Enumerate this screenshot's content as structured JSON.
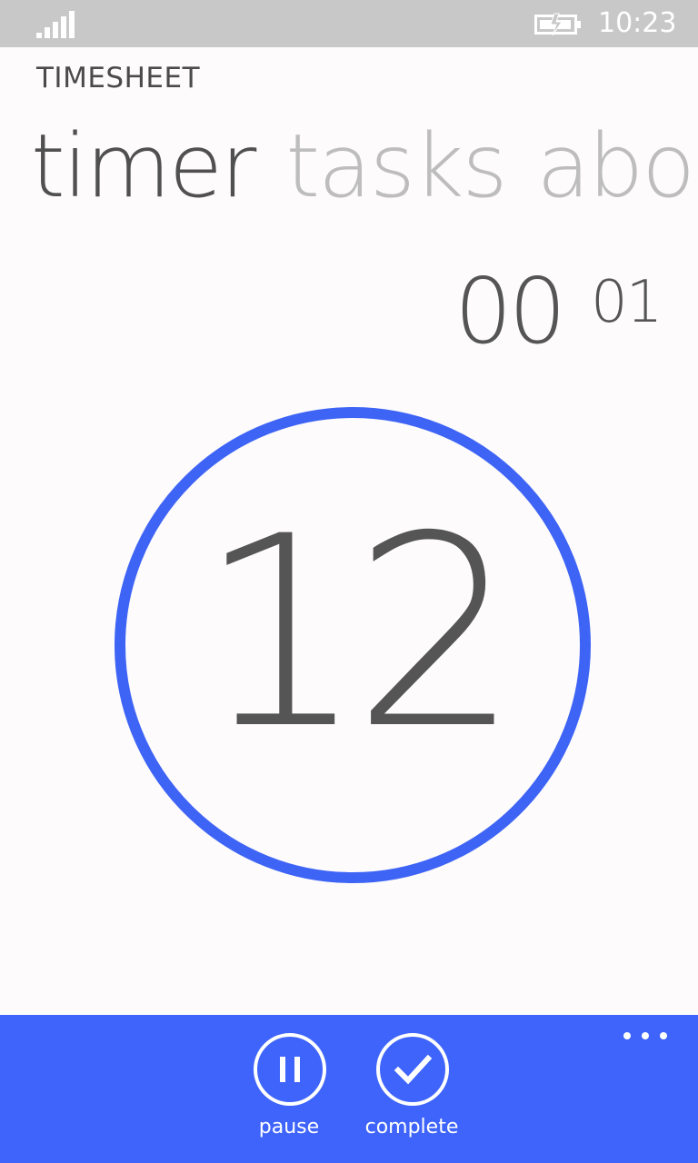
{
  "status_bar": {
    "time": "10:23",
    "signal_icon": "signal-strength-icon",
    "battery_icon": "battery-charging-icon"
  },
  "app": {
    "title": "TIMESHEET"
  },
  "pivot": {
    "items": [
      {
        "label": "timer",
        "active": true
      },
      {
        "label": "tasks",
        "active": false
      },
      {
        "label": "about",
        "active": false
      }
    ]
  },
  "timer": {
    "elapsed_primary": "00",
    "elapsed_secondary": "01",
    "ring_value": "12",
    "ring_color": "#3e64f5"
  },
  "app_bar": {
    "background": "#3e64fb",
    "buttons": [
      {
        "label": "pause",
        "icon": "pause-icon"
      },
      {
        "label": "complete",
        "icon": "check-icon"
      }
    ],
    "more_icon": "ellipsis-icon"
  }
}
